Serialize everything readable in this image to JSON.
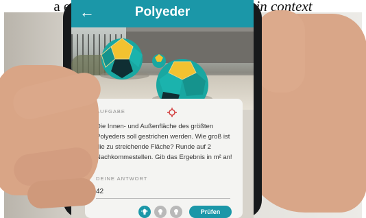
{
  "caption": {
    "prefix": "a encore à celle de ",
    "italic": "Mathématiques in context"
  },
  "app": {
    "title": "Polyeder",
    "back_icon": "←"
  },
  "task": {
    "label": "AUFGABE",
    "text": "Die Innen- und Außenfläche des größten Polyeders soll gestrichen werden. Wie groß ist die zu streichende Fläche? Runde auf 2 Nachkommestellen. Gib das Ergebnis in m² an!"
  },
  "answer": {
    "label": "DEINE ANTWORT",
    "value": "42"
  },
  "buttons": {
    "check_label": "Prüfen"
  },
  "hints": [
    {
      "icon": "lightbulb-icon",
      "state": "active"
    },
    {
      "icon": "lightbulb-icon",
      "state": "inactive"
    },
    {
      "icon": "lightbulb-icon",
      "state": "inactive"
    }
  ],
  "colors": {
    "accent": "#1b97a8",
    "polyhedron_teal": "#19a7a1",
    "polyhedron_yellow": "#f2c230",
    "crosshair": "#d23c3c"
  }
}
